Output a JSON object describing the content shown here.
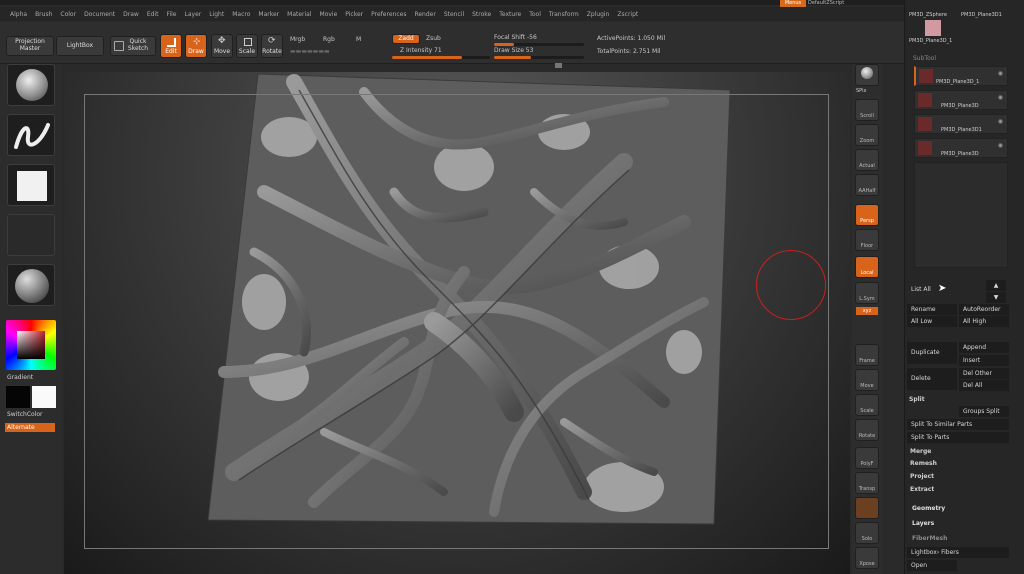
{
  "menubar": {
    "items": [
      "Alpha",
      "Brush",
      "Color",
      "Document",
      "Draw",
      "Edit",
      "File",
      "Layer",
      "Light",
      "Macro",
      "Marker",
      "Material",
      "Movie",
      "Picker",
      "Preferences",
      "Render",
      "Stencil",
      "Stroke",
      "Texture",
      "Tool",
      "Transform",
      "Zplugin",
      "Zscript"
    ],
    "menus_label": "Menus",
    "script_label": "DefaultZScript"
  },
  "toolbar": {
    "projection_master": "Projection Master",
    "lightbox": "LightBox",
    "quick_sketch": "Quick Sketch",
    "edit": "Edit",
    "draw": "Draw",
    "move": "Move",
    "scale": "Scale",
    "rotate": "Rotate",
    "mrgb": "Mrgb",
    "rgb": "Rgb",
    "m": "M",
    "zadd": "Zadd",
    "zsub": "Zsub",
    "z_intensity": "Z Intensity 71",
    "z_intensity_value": 71,
    "focal_shift": "Focal Shift -56",
    "focal_shift_value": -56,
    "draw_size": "Draw Size 53",
    "draw_size_value": 53,
    "active_points": "ActivePoints: 1.050 Mil",
    "total_points": "TotalPoints: 2.751 Mil"
  },
  "leftshelf": {
    "gradient": "Gradient",
    "switch_color": "SwitchColor",
    "alternate": "Alternate"
  },
  "rightshelf": {
    "buttons": [
      "SPix",
      "Scroll",
      "Zoom",
      "Actual",
      "AAHalf",
      "Persp",
      "Floor",
      "Local",
      "L.Sym",
      "Frame",
      "Move",
      "Scale",
      "Rotate",
      "PolyF",
      "Transp",
      "Solo",
      "Xpose"
    ],
    "xyz": "xyz"
  },
  "subtool": {
    "header": "SubTool",
    "items": [
      "PM3D_Plane3D_1",
      "PM3D_Plane3D",
      "PM3D_Plane3D1",
      "PM3D_Plane3D"
    ],
    "top_thumb_label": "PM3D_ZSphere",
    "top_thumb_label_2": "PM3D_Plane3D1",
    "top_thumb_label_3": "PM3D_Plane3D_1"
  },
  "panel": {
    "list_all": "List All",
    "rename": "Rename",
    "auto_reorder": "AutoReorder",
    "all_low": "All Low",
    "all_high": "All High",
    "duplicate": "Duplicate",
    "append": "Append",
    "insert": "Insert",
    "delete": "Delete",
    "del_other": "Del Other",
    "del_all": "Del All",
    "split": "Split",
    "groups_split": "Groups Split",
    "split_similar": "Split To Similar Parts",
    "split_parts": "Split To Parts",
    "merge": "Merge",
    "remesh": "Remesh",
    "project": "Project",
    "extract": "Extract",
    "geometry": "Geometry",
    "layers": "Layers",
    "fibermesh": "FiberMesh",
    "lightbox_fibers": "Lightbox› Fibers",
    "open": "Open"
  }
}
